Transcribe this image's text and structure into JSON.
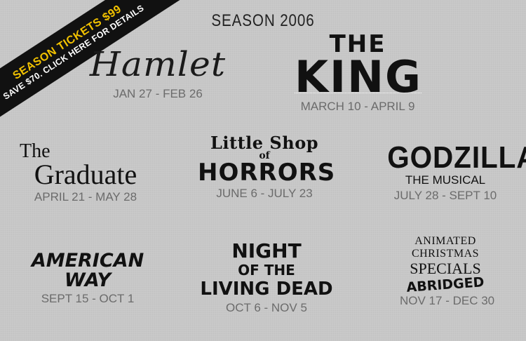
{
  "header": {
    "title": "SEASON 2006"
  },
  "banner": {
    "line1": "SEASON TICKETS $99",
    "line2": "SAVE $70. CLICK HERE FOR DETAILS"
  },
  "shows": {
    "hamlet": {
      "title": "Hamlet",
      "dates": "JAN 27 - FEB 26"
    },
    "king": {
      "title_top": "THE",
      "title_main": "KING",
      "dates": "MARCH 10 - APRIL 9"
    },
    "graduate": {
      "title_top": "The",
      "title_main": "Graduate",
      "dates": "APRIL 21 - MAY 28"
    },
    "shop": {
      "title_top": "Little Shop",
      "title_mid": "of",
      "title_main": "HORRORS",
      "dates": "JUNE 6 - JULY 23"
    },
    "godzilla": {
      "title_main": "GODZILLA",
      "title_sub": "THE MUSICAL",
      "dates": "JULY 28 - SEPT 10"
    },
    "american": {
      "title_top": "AMERICAN",
      "title_main": "WAY",
      "dates": "SEPT 15 - OCT 1"
    },
    "night": {
      "title_top": "NIGHT",
      "title_mid": "OF THE",
      "title_main": "LIVING DEAD",
      "dates": "OCT 6 - NOV 5"
    },
    "animated": {
      "title_top": "ANIMATED",
      "title_mid": "CHRISTMAS",
      "title_main": "SPECIALS",
      "title_sub": "ABRIDGED",
      "dates": "NOV 17 - DEC 30"
    }
  },
  "colors": {
    "background": "#c9c9c9",
    "banner": "#111111",
    "banner_accent": "#f2c200",
    "dates": "#6b6b6b"
  }
}
